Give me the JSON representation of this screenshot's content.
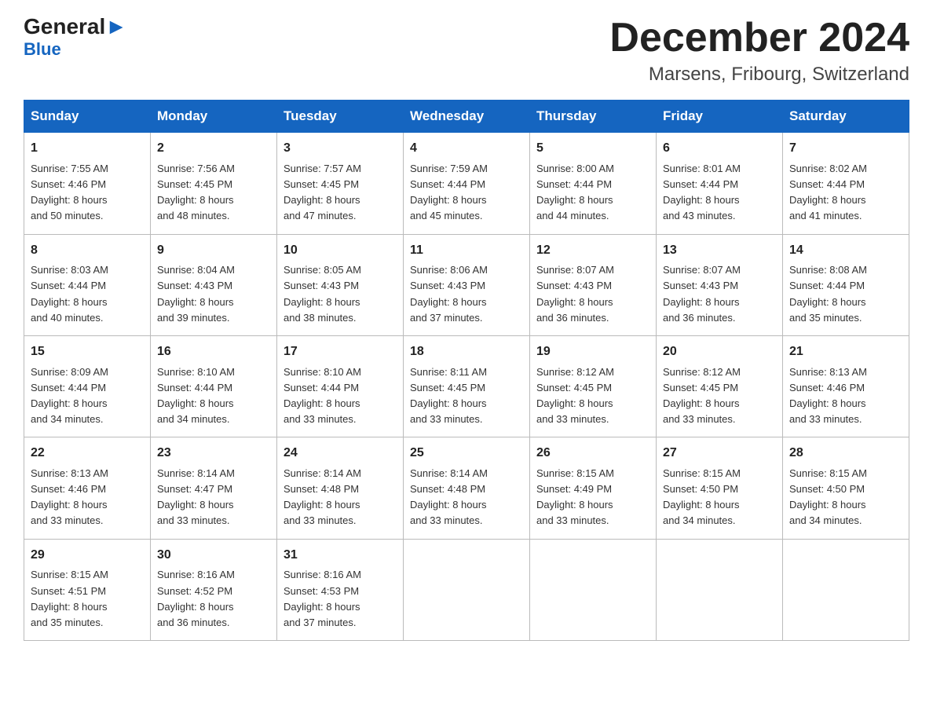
{
  "logo": {
    "general": "General",
    "arrow": "▶",
    "blue": "Blue"
  },
  "title": {
    "month_year": "December 2024",
    "location": "Marsens, Fribourg, Switzerland"
  },
  "weekdays": [
    "Sunday",
    "Monday",
    "Tuesday",
    "Wednesday",
    "Thursday",
    "Friday",
    "Saturday"
  ],
  "weeks": [
    [
      {
        "day": "1",
        "sunrise": "7:55 AM",
        "sunset": "4:46 PM",
        "daylight": "8 hours and 50 minutes."
      },
      {
        "day": "2",
        "sunrise": "7:56 AM",
        "sunset": "4:45 PM",
        "daylight": "8 hours and 48 minutes."
      },
      {
        "day": "3",
        "sunrise": "7:57 AM",
        "sunset": "4:45 PM",
        "daylight": "8 hours and 47 minutes."
      },
      {
        "day": "4",
        "sunrise": "7:59 AM",
        "sunset": "4:44 PM",
        "daylight": "8 hours and 45 minutes."
      },
      {
        "day": "5",
        "sunrise": "8:00 AM",
        "sunset": "4:44 PM",
        "daylight": "8 hours and 44 minutes."
      },
      {
        "day": "6",
        "sunrise": "8:01 AM",
        "sunset": "4:44 PM",
        "daylight": "8 hours and 43 minutes."
      },
      {
        "day": "7",
        "sunrise": "8:02 AM",
        "sunset": "4:44 PM",
        "daylight": "8 hours and 41 minutes."
      }
    ],
    [
      {
        "day": "8",
        "sunrise": "8:03 AM",
        "sunset": "4:44 PM",
        "daylight": "8 hours and 40 minutes."
      },
      {
        "day": "9",
        "sunrise": "8:04 AM",
        "sunset": "4:43 PM",
        "daylight": "8 hours and 39 minutes."
      },
      {
        "day": "10",
        "sunrise": "8:05 AM",
        "sunset": "4:43 PM",
        "daylight": "8 hours and 38 minutes."
      },
      {
        "day": "11",
        "sunrise": "8:06 AM",
        "sunset": "4:43 PM",
        "daylight": "8 hours and 37 minutes."
      },
      {
        "day": "12",
        "sunrise": "8:07 AM",
        "sunset": "4:43 PM",
        "daylight": "8 hours and 36 minutes."
      },
      {
        "day": "13",
        "sunrise": "8:07 AM",
        "sunset": "4:43 PM",
        "daylight": "8 hours and 36 minutes."
      },
      {
        "day": "14",
        "sunrise": "8:08 AM",
        "sunset": "4:44 PM",
        "daylight": "8 hours and 35 minutes."
      }
    ],
    [
      {
        "day": "15",
        "sunrise": "8:09 AM",
        "sunset": "4:44 PM",
        "daylight": "8 hours and 34 minutes."
      },
      {
        "day": "16",
        "sunrise": "8:10 AM",
        "sunset": "4:44 PM",
        "daylight": "8 hours and 34 minutes."
      },
      {
        "day": "17",
        "sunrise": "8:10 AM",
        "sunset": "4:44 PM",
        "daylight": "8 hours and 33 minutes."
      },
      {
        "day": "18",
        "sunrise": "8:11 AM",
        "sunset": "4:45 PM",
        "daylight": "8 hours and 33 minutes."
      },
      {
        "day": "19",
        "sunrise": "8:12 AM",
        "sunset": "4:45 PM",
        "daylight": "8 hours and 33 minutes."
      },
      {
        "day": "20",
        "sunrise": "8:12 AM",
        "sunset": "4:45 PM",
        "daylight": "8 hours and 33 minutes."
      },
      {
        "day": "21",
        "sunrise": "8:13 AM",
        "sunset": "4:46 PM",
        "daylight": "8 hours and 33 minutes."
      }
    ],
    [
      {
        "day": "22",
        "sunrise": "8:13 AM",
        "sunset": "4:46 PM",
        "daylight": "8 hours and 33 minutes."
      },
      {
        "day": "23",
        "sunrise": "8:14 AM",
        "sunset": "4:47 PM",
        "daylight": "8 hours and 33 minutes."
      },
      {
        "day": "24",
        "sunrise": "8:14 AM",
        "sunset": "4:48 PM",
        "daylight": "8 hours and 33 minutes."
      },
      {
        "day": "25",
        "sunrise": "8:14 AM",
        "sunset": "4:48 PM",
        "daylight": "8 hours and 33 minutes."
      },
      {
        "day": "26",
        "sunrise": "8:15 AM",
        "sunset": "4:49 PM",
        "daylight": "8 hours and 33 minutes."
      },
      {
        "day": "27",
        "sunrise": "8:15 AM",
        "sunset": "4:50 PM",
        "daylight": "8 hours and 34 minutes."
      },
      {
        "day": "28",
        "sunrise": "8:15 AM",
        "sunset": "4:50 PM",
        "daylight": "8 hours and 34 minutes."
      }
    ],
    [
      {
        "day": "29",
        "sunrise": "8:15 AM",
        "sunset": "4:51 PM",
        "daylight": "8 hours and 35 minutes."
      },
      {
        "day": "30",
        "sunrise": "8:16 AM",
        "sunset": "4:52 PM",
        "daylight": "8 hours and 36 minutes."
      },
      {
        "day": "31",
        "sunrise": "8:16 AM",
        "sunset": "4:53 PM",
        "daylight": "8 hours and 37 minutes."
      },
      null,
      null,
      null,
      null
    ]
  ],
  "labels": {
    "sunrise": "Sunrise:",
    "sunset": "Sunset:",
    "daylight": "Daylight:"
  }
}
